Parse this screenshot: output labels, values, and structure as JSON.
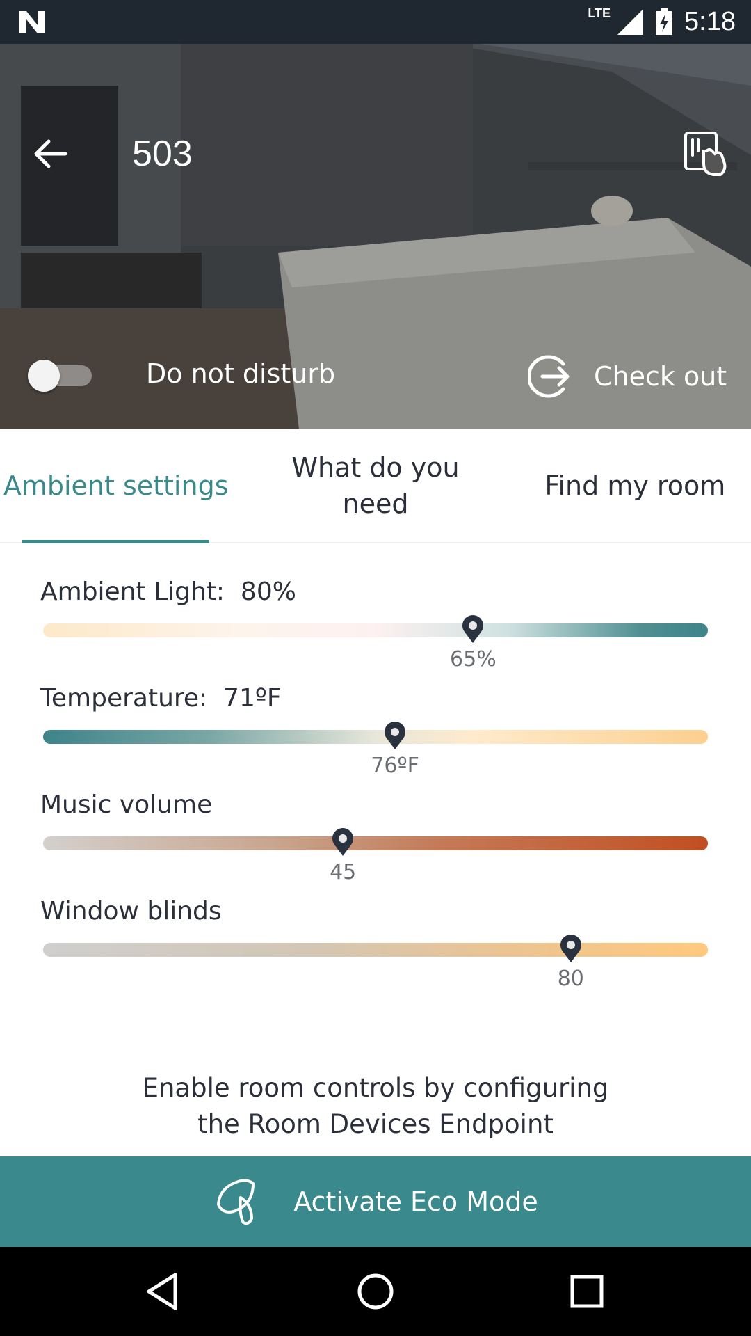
{
  "status_bar": {
    "network_label": "LTE",
    "time": "5:18",
    "icons": [
      "notification-n-icon",
      "signal-icon",
      "battery-charging-icon"
    ]
  },
  "header": {
    "room_number": "503",
    "back_icon": "arrow-left-icon",
    "key_icon": "key-card-tap-icon"
  },
  "hero_controls": {
    "dnd_label": "Do not disturb",
    "dnd_on": false,
    "checkout_label": "Check out",
    "checkout_icon": "exit-arrow-circle-icon"
  },
  "tabs": [
    {
      "label": "Ambient settings",
      "active": true
    },
    {
      "label": "What do you need",
      "active": false
    },
    {
      "label": "Find my room",
      "active": false
    }
  ],
  "sliders": [
    {
      "label": "Ambient Light:  80%",
      "value_text": "65%",
      "level": 0.65
    },
    {
      "label": "Temperature:  71ºF",
      "value_text": "76ºF",
      "level": 0.53
    },
    {
      "label": "Music volume",
      "value_text": "45",
      "level": 0.45
    },
    {
      "label": "Window blinds",
      "value_text": "80",
      "level": 0.8
    }
  ],
  "info": {
    "line1": "Enable room controls by configuring",
    "line2": "the Room Devices Endpoint"
  },
  "eco_button": {
    "label": "Activate Eco Mode",
    "icon": "leaf-icon"
  },
  "nav_bar": {
    "icons": [
      "back-triangle-icon",
      "home-circle-icon",
      "recents-square-icon"
    ]
  },
  "colors": {
    "accent": "#3a8a8b",
    "status_bar_bg": "#1f2731",
    "eco_button_bg": "#3a8a8d"
  }
}
